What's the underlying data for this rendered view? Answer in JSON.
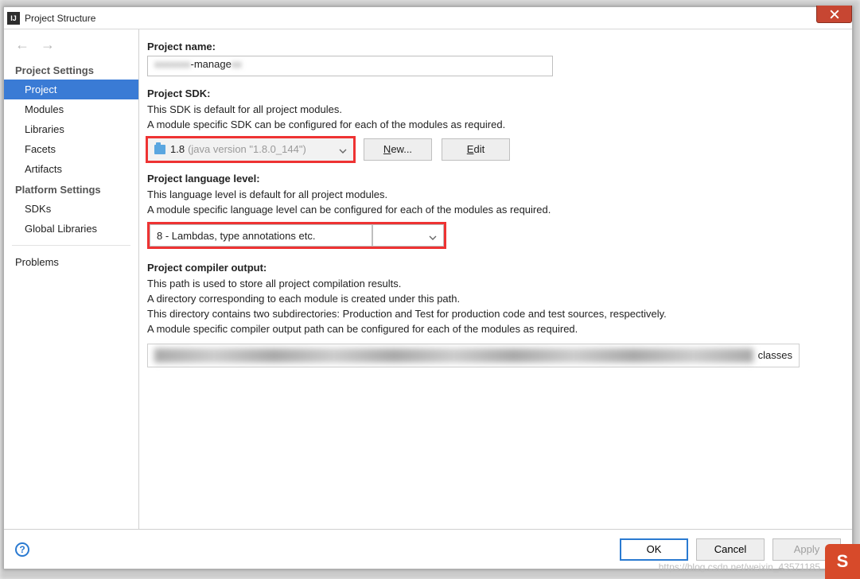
{
  "window": {
    "title": "Project Structure"
  },
  "sidebar": {
    "nav_back": "←",
    "nav_forward": "→",
    "groups": [
      {
        "label": "Project Settings",
        "items": [
          "Project",
          "Modules",
          "Libraries",
          "Facets",
          "Artifacts"
        ],
        "selected_index": 0
      },
      {
        "label": "Platform Settings",
        "items": [
          "SDKs",
          "Global Libraries"
        ]
      },
      {
        "label": "",
        "items": [
          "Problems"
        ]
      }
    ]
  },
  "project_name": {
    "label": "Project name:",
    "value": "-manage"
  },
  "project_sdk": {
    "label": "Project SDK:",
    "desc1": "This SDK is default for all project modules.",
    "desc2": "A module specific SDK can be configured for each of the modules as required.",
    "selected_version": "1.8",
    "selected_detail": "(java version \"1.8.0_144\")",
    "new_button": "New...",
    "edit_button": "Edit"
  },
  "language_level": {
    "label": "Project language level:",
    "desc1": "This language level is default for all project modules.",
    "desc2": "A module specific language level can be configured for each of the modules as required.",
    "selected": "8 - Lambdas, type annotations etc."
  },
  "compiler_output": {
    "label": "Project compiler output:",
    "desc1": "This path is used to store all project compilation results.",
    "desc2": "A directory corresponding to each module is created under this path.",
    "desc3": "This directory contains two subdirectories: Production and Test for production code and test sources, respectively.",
    "desc4": "A module specific compiler output path can be configured for each of the modules as required.",
    "suffix": "classes"
  },
  "footer": {
    "help": "?",
    "ok": "OK",
    "cancel": "Cancel",
    "apply": "Apply"
  },
  "watermark": {
    "text": "https://blog.csdn.net/weixin_43571185",
    "badge": "S"
  }
}
